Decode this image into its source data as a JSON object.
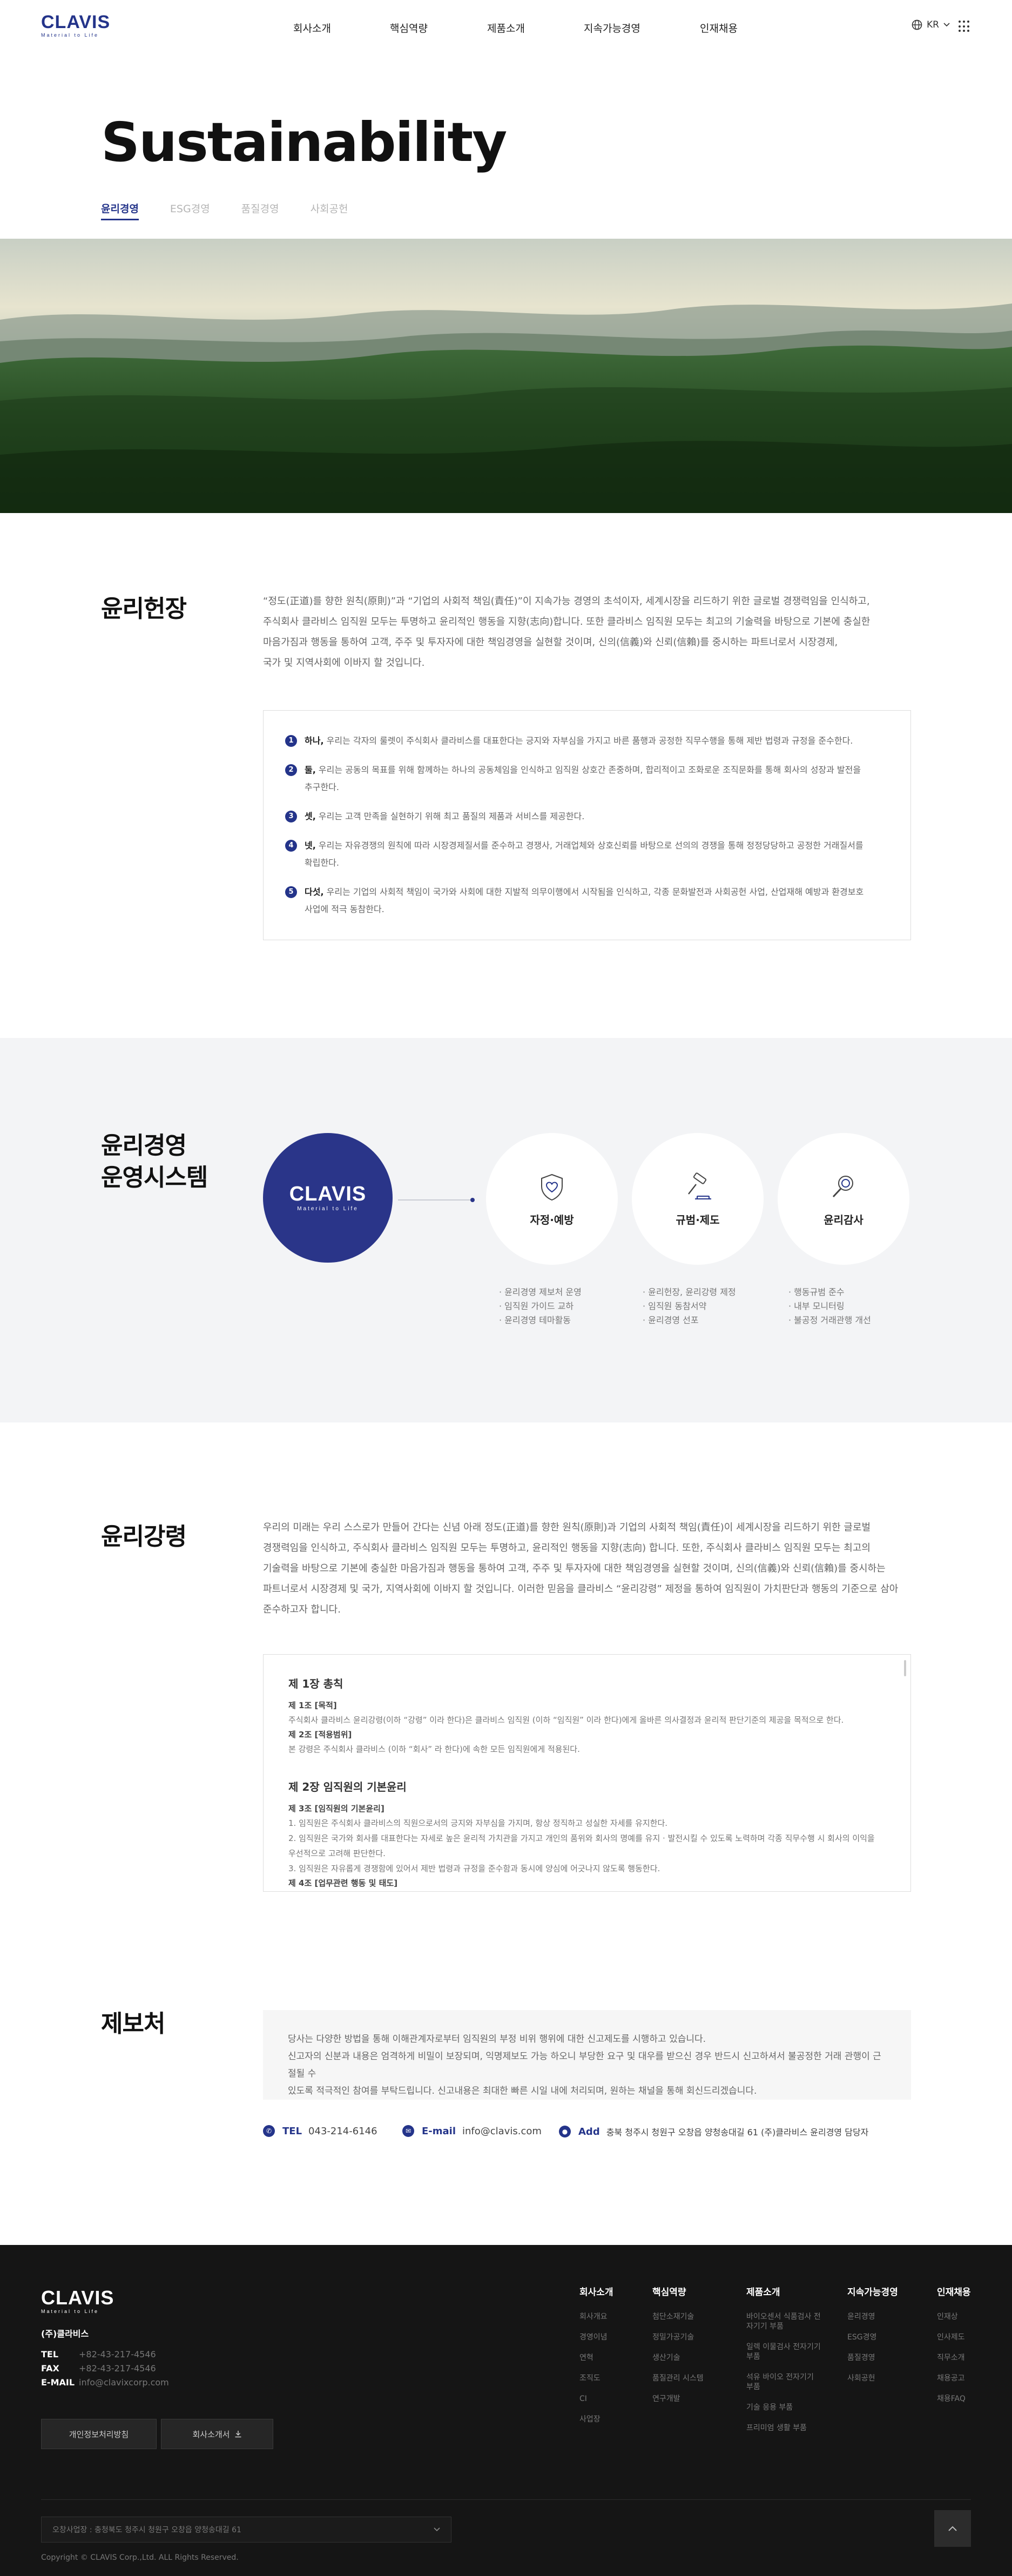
{
  "header": {
    "logo_text": "CLAVIS",
    "logo_tagline": "Material to Life",
    "nav": [
      "회사소개",
      "핵심역량",
      "제품소개",
      "지속가능경영",
      "인재채용"
    ],
    "lang": "KR"
  },
  "hero": {
    "title": "Sustainability",
    "tabs": [
      "윤리경영",
      "ESG경영",
      "품질경영",
      "사회공헌"
    ],
    "active_tab": "윤리경영"
  },
  "charter": {
    "heading": "윤리헌장",
    "intro_lines": [
      "“정도(正道)를 향한 원칙(原則)”과  “기업의 사회적 책임(責任)”이 지속가능 경영의 초석이자, 세계시장을 리드하기 위한 글로벌 경쟁력임을 인식하고,",
      "주식회사 클라비스 임직원 모두는 투명하고 윤리적인 행동을 지향(志向)합니다. 또한 클라비스 임직원 모두는 최고의 기술력을 바탕으로 기본에 충실한",
      "마음가짐과 행동을 통하여 고객, 주주 및 투자자에 대한 책임경영을 실현할 것이며, 신의(信義)와 신뢰(信賴)를 중시하는 파트너로서 시장경제,",
      "국가 및 지역사회에 이바지 할 것입니다."
    ],
    "items": [
      {
        "num": "1",
        "lead": "하나,",
        "lines": [
          "우리는 각자의 룰렛이 주식회사 클라비스를 대표한다는 긍지와 자부심을 가지고 바른 품행과 공정한 직무수행을 통해 제반 법령과 규정을 준수한다."
        ]
      },
      {
        "num": "2",
        "lead": "둘,",
        "lines": [
          "우리는 공동의 목표를 위해 함께하는 하나의 공동체임을 인식하고 임직원 상호간 존중하며, 합리적이고 조화로운 조직문화를 통해 회사의 성장과 발전을",
          "추구한다."
        ]
      },
      {
        "num": "3",
        "lead": "셋,",
        "lines": [
          "우리는 고객 만족을 실현하기 위해 최고 품질의 제품과 서비스를 제공한다."
        ]
      },
      {
        "num": "4",
        "lead": "넷,",
        "lines": [
          "우리는 자유경쟁의 원칙에 따라 시장경제질서를 준수하고 경쟁사, 거래업체와 상호신뢰를 바탕으로 선의의 경쟁을 통해 정정당당하고 공정한 거래질서를",
          "확립한다."
        ]
      },
      {
        "num": "5",
        "lead": "다섯,",
        "lines": [
          "우리는 기업의 사회적 책임이 국가와 사회에 대한 지발적 의무이행에서 시작됨을 인식하고, 각종 문화발전과 사회공헌 사업, 산업재해 예방과 환경보호",
          "사업에 적극 동참한다."
        ]
      }
    ]
  },
  "system": {
    "heading_lines": [
      "윤리경영",
      "운영시스템"
    ],
    "logo_text": "CLAVIS",
    "logo_tagline": "Material to Life",
    "circles": [
      {
        "icon": "shield-heart-icon",
        "label": "자정·예방",
        "bullets": [
          "· 윤리경영 제보처 운영",
          "· 임직원 가이드 교하",
          "· 윤리경영 테마활동"
        ]
      },
      {
        "icon": "gavel-icon",
        "label": "규범·제도",
        "bullets": [
          "· 윤리헌장, 윤리강령 제정",
          "· 임직원 동참서약",
          "· 윤리경영 선포"
        ]
      },
      {
        "icon": "magnifier-icon",
        "label": "윤리감사",
        "bullets": [
          "· 행동규범 준수",
          "· 내부 모니터링",
          "· 불공정 거래관행 개선"
        ]
      }
    ]
  },
  "code": {
    "heading": "윤리강령",
    "intro_lines": [
      "우리의 미래는 우리 스스로가 만들어 간다는 신념 아래 정도(正道)를 향한 원칙(原則)과 기업의 사회적 책임(責任)이 세계시장을 리드하기 위한 글로벌",
      "경쟁력임을 인식하고, 주식회사 클라비스 임직원 모두는 투명하고, 윤리적인 행동을 지향(志向) 합니다. 또한, 주식회사 클라비스 임직원 모두는 최고의",
      "기술력을 바탕으로 기본에 충실한 마음가짐과 행동을 통하여 고객, 주주 및 투자자에 대한 책임경영을 실현할 것이며, 신의(信義)와 신뢰(信賴)를 중시하는",
      "파트너로서 시장경제 및 국가, 지역사회에 이바지 할 것입니다. 이러한 믿음을 클라비스  “윤리강령”  제정을 통하여 임직원이 가치판단과 행동의 기준으로 삼아",
      "준수하고자 합니다."
    ],
    "chapter1_title": "제 1장 총칙",
    "ch1": [
      {
        "art": "제 1조 [목적]",
        "txt": "주식회사 클라비스 윤리강령(이하  “강령”  이라 한다)은 클라비스 임직원 (이하  “임직원”  이라 한다)에게 올바른 의사결정과 윤리적 판단기준의 제공을 목적으로 한다."
      },
      {
        "art": "제 2조 [적용범위]",
        "txt": "본 강령은 주식회사 클라비스 (이하  “회사”  라 한다)에 속한 모든 임직원에게 적용된다."
      }
    ],
    "chapter2_title": "제 2장 임직원의 기본윤리",
    "ch2_art": "제 3조 [임직원의 기본윤리]",
    "ch2_lines": [
      "1. 임직원은 주식회사 클라비스의 직원으로서의 긍지와 자부심을 가지며, 항상 정직하고 성실한 자세를 유지한다.",
      "2. 임직원은 국가와 회사를 대표한다는 자세로 높은 윤리적 가치관을 가지고 개인의 품위와 회사의 명예를 유지 · 발전시킬 수 있도록 노력하며 각종 직무수행 시 회사의 이익을",
      "우선적으로 고려해 판단한다.",
      "3. 임직원은 자유롭게 경쟁함에 있어서 제반 법령과 규정을 준수함과 동시에 양심에 어긋나지 않도록 행동한다."
    ],
    "ch2_next": "제 4조 [업무관련 행동 및 태도]"
  },
  "report": {
    "heading": "제보처",
    "lines": [
      "당사는 다양한 방법을 통해 이해관계자로부터 임직원의 부정 비위 행위에 대한 신고제도를 시행하고 있습니다.",
      "신고자의 신분과 내용은 엄격하게 비밀이 보장되며, 익명제보도 가능 하오니 부당한 요구 및 대우를 받으신 경우 반드시 신고하셔서 불공정한 거래 관행이 근절될 수",
      "있도록 적극적인 참여를 부탁드립니다. 신고내용은 최대한 빠른 시일 내에 처리되며, 원하는 채널을 통해 회신드리겠습니다."
    ],
    "tel_label": "TEL",
    "tel": "043-214-6146",
    "email_label": "E-mail",
    "email": "info@clavis.com",
    "addr_label": "Add",
    "addr": "충북 청주시 청원구 오창읍 양청송대길 61 (주)클라비스 윤리경영 담당자"
  },
  "footer": {
    "logo_text": "CLAVIS",
    "logo_tagline": "Material to Life",
    "company": "(주)클라비스",
    "tel_label": "TEL",
    "tel": "+82-43-217-4546",
    "fax_label": "FAX",
    "fax": "+82-43-217-4546",
    "email_label": "E-MAIL",
    "email": "info@clavixcorp.com",
    "btn_privacy": "개인정보처리방침",
    "btn_brochure": "회사소개서",
    "columns": [
      {
        "title": "회사소개",
        "items": [
          "회사개요",
          "경영이념",
          "연혁",
          "조직도",
          "CI",
          "사업장"
        ]
      },
      {
        "title": "핵심역량",
        "items": [
          "첨단소재기술",
          "정밀가공기술",
          "생산기술",
          "품질관리 시스템",
          "연구개발"
        ]
      },
      {
        "title": "제품소개",
        "items": [
          "바이오센서 식품검사 전자기기 부품",
          "일렉 이물검사 전자기기 부품",
          "석유 바이오 전자기기 부품",
          "기술 응용 부품",
          "프리미엄 생활 부품"
        ]
      },
      {
        "title": "지속가능경영",
        "items": [
          "윤리경영",
          "ESG경영",
          "품질경영",
          "사회공헌"
        ]
      },
      {
        "title": "인재채용",
        "items": [
          "인재상",
          "인사제도",
          "직무소개",
          "채용공고",
          "채용FAQ"
        ]
      }
    ],
    "family_select": "오창사업장 : 충청북도 청주시 청원구 오창읍 양청송대길 61",
    "copyright": "Copyright © CLAVIS Corp.,Ltd. ALL Rights Reserved."
  }
}
